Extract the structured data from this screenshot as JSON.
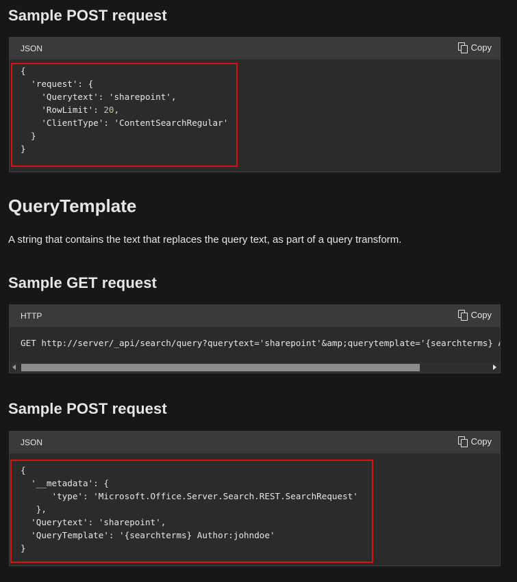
{
  "sections": [
    {
      "heading": "Sample POST request",
      "lang": "JSON",
      "copy_label": "Copy",
      "code": "{\n  'request': {\n    'Querytext': 'sharepoint',\n    'RowLimit': 20,\n    'ClientType': 'ContentSearchRegular'\n  }\n}"
    },
    {
      "big_heading": "QueryTemplate",
      "description": "A string that contains the text that replaces the query text, as part of a query transform."
    },
    {
      "heading": "Sample GET request",
      "lang": "HTTP",
      "copy_label": "Copy",
      "code": "GET http://server/_api/search/query?querytext='sharepoint'&amp;querytemplate='{searchterms} Author:johndoe'"
    },
    {
      "heading": "Sample POST request",
      "lang": "JSON",
      "copy_label": "Copy",
      "code": "{\n  '__metadata': {\n      'type': 'Microsoft.Office.Server.Search.REST.SearchRequest'\n   },\n  'Querytext': 'sharepoint',\n  'QueryTemplate': '{searchterms} Author:johndoe'\n}"
    }
  ],
  "colors": {
    "background": "#171717",
    "code_bg": "#2b2b2b",
    "header_bg": "#3a3a3a",
    "highlight": "#e01010",
    "url": "#4fc1ff",
    "number": "#b5cea8"
  },
  "icons": {
    "copy": "copy-icon",
    "scroll_left": "chevron-left-icon",
    "scroll_right": "chevron-right-icon"
  }
}
